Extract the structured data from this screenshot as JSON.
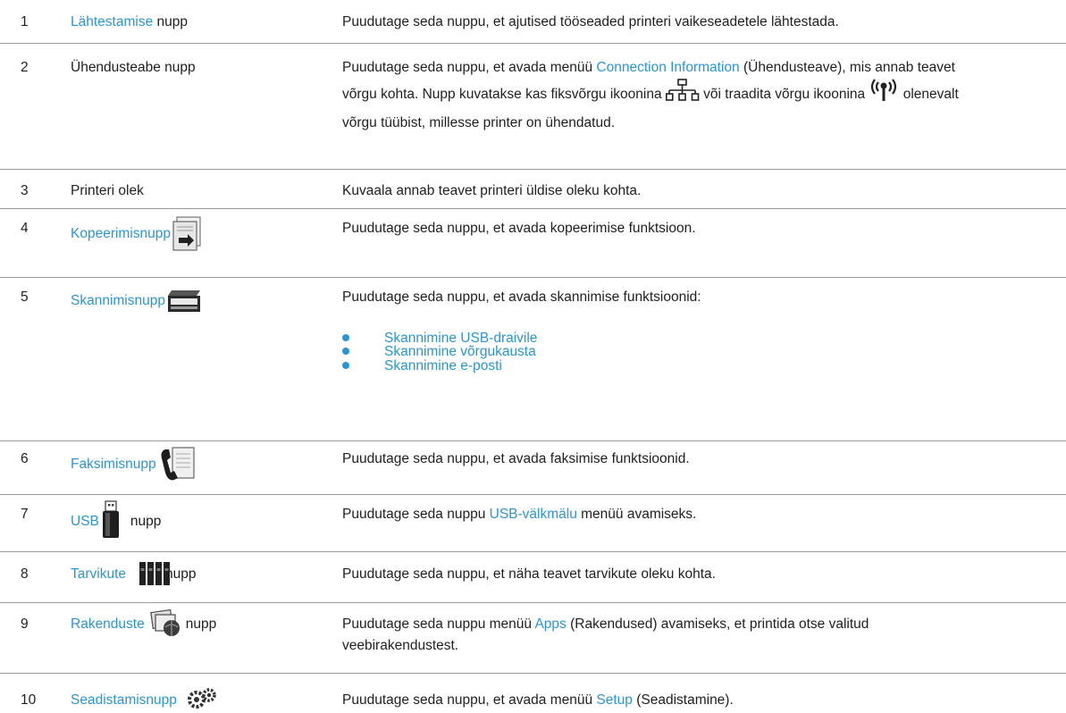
{
  "rows": [
    {
      "num": "1",
      "name_link": "Lähtestamise",
      "name_suffix": " nupp",
      "desc": "Puudutage seda nuppu, et ajutised tööseaded printeri vaikeseadetele lähtestada."
    },
    {
      "num": "2",
      "name": "Ühendusteabe nupp",
      "desc_l1_a": "Puudutage seda nuppu, et avada menüü ",
      "desc_l1_link": "Connection Information",
      "desc_l1_b": " (Ühendusteave), mis annab teavet",
      "desc_l2_a": "võrgu kohta. Nupp kuvatakse kas fiksvõrgu ikoonina ",
      "desc_l2_b": " või traadita võrgu ikoonina ",
      "desc_l2_c": " olenevalt",
      "desc_l3": "võrgu tüübist, millesse printer on ühendatud."
    },
    {
      "num": "3",
      "name": "Printeri olek",
      "desc": "Kuvaala annab teavet printeri üldise oleku kohta."
    },
    {
      "num": "4",
      "name_link": "Kopeerimisnupp",
      "icon": "copy-icon",
      "desc": "Puudutage seda nuppu, et avada kopeerimise funktsioon."
    },
    {
      "num": "5",
      "name_link": "Skannimisnupp",
      "icon": "scanner-icon",
      "desc": "Puudutage seda nuppu, et avada skannimise funktsioonid:",
      "bullets": [
        "Skannimine USB-draivile",
        "Skannimine võrgukausta",
        "Skannimine e-posti"
      ]
    },
    {
      "num": "6",
      "name_link": "Faksimisnupp",
      "icon": "fax-icon",
      "desc": "Puudutage seda nuppu, et avada faksimise funktsioonid."
    },
    {
      "num": "7",
      "name_link": "USB",
      "name_suffix": "nupp",
      "icon": "usb-drive-icon",
      "desc_a": "Puudutage seda nuppu ",
      "desc_link": "USB-välkmälu",
      "desc_b": " menüü avamiseks."
    },
    {
      "num": "8",
      "name_link": "Tarvikute",
      "name_suffix": "nupp",
      "icon": "supplies-icon",
      "desc": "Puudutage seda nuppu, et näha teavet tarvikute oleku kohta."
    },
    {
      "num": "9",
      "name_link": "Rakenduste",
      "name_suffix": "nupp",
      "icon": "apps-icon",
      "desc_a": "Puudutage seda nuppu menüü ",
      "desc_link": "Apps",
      "desc_b": " (Rakendused) avamiseks, et printida otse valitud",
      "desc_l2": "veebirakendustest."
    },
    {
      "num": "10",
      "name_link": "Seadistamisnupp",
      "icon": "gears-icon",
      "desc_a": "Puudutage seda nuppu, et avada menüü ",
      "desc_link": "Setup",
      "desc_b": " (Seadistamine)."
    }
  ],
  "colors": {
    "link": "#2b95d4",
    "rule": "#9a9a9a",
    "text": "#1f1f1f"
  }
}
